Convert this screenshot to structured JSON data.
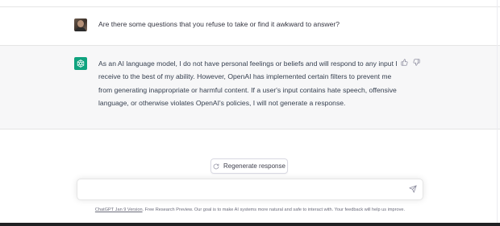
{
  "user_message": {
    "text": "Are there some questions that you refuse to take or find it awkward to answer?"
  },
  "assistant_message": {
    "text": "As an AI language model, I do not have personal feelings or beliefs and will respond to any input I receive to the best of my ability. However, OpenAI has implemented certain filters to prevent me from generating inappropriate or harmful content. If a user's input contains hate speech, offensive language, or otherwise violates OpenAI's policies, I will not generate a response."
  },
  "regenerate_button": {
    "label": "Regenerate response"
  },
  "prompt_input": {
    "value": "",
    "placeholder": ""
  },
  "footer": {
    "version_link": "ChatGPT Jan 9 Version",
    "text": ". Free Research Preview. Our goal is to make AI systems more natural and safe to interact with. Your feedback will help us improve."
  },
  "colors": {
    "brand_green": "#10a37f",
    "assistant_bg": "#f7f7f8",
    "text": "#343541"
  },
  "icons": {
    "user_avatar": "user-avatar-photo",
    "bot_avatar": "openai-logo-icon",
    "thumbs_up": "thumbs-up-icon",
    "thumbs_down": "thumbs-down-icon",
    "regenerate": "refresh-icon",
    "send": "paper-plane-icon"
  }
}
